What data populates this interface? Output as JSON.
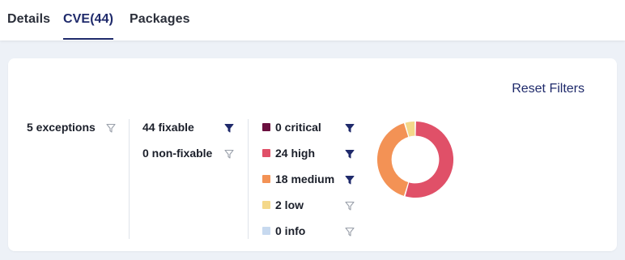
{
  "tabs": [
    {
      "label": "Details"
    },
    {
      "label": "CVE(44)"
    },
    {
      "label": "Packages"
    }
  ],
  "reset_filters_label": "Reset Filters",
  "exceptions": {
    "label": "5 exceptions",
    "filter_active": false
  },
  "fixable": [
    {
      "label": "44 fixable",
      "filter_active": true
    },
    {
      "label": "0 non-fixable",
      "filter_active": false
    }
  ],
  "severity": [
    {
      "label": "0 critical",
      "count": 0,
      "color": "#6b0f3f",
      "filter_active": true
    },
    {
      "label": "24 high",
      "count": 24,
      "color": "#e05068",
      "filter_active": true
    },
    {
      "label": "18 medium",
      "count": 18,
      "color": "#f39255",
      "filter_active": true
    },
    {
      "label": "2 low",
      "count": 2,
      "color": "#f4d88a",
      "filter_active": false
    },
    {
      "label": "0 info",
      "count": 0,
      "color": "#c7d9ef",
      "filter_active": false
    }
  ],
  "colors": {
    "accent": "#1f2a6b",
    "filter_inactive": "#9aa0aa"
  }
}
